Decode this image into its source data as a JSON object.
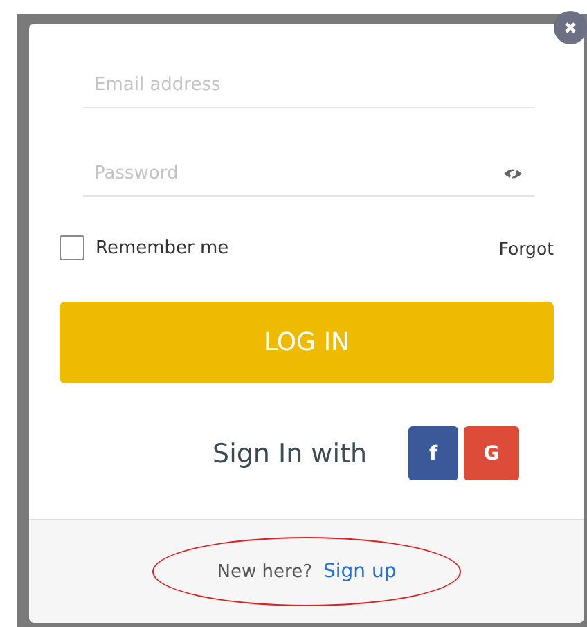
{
  "email": {
    "placeholder": "Email address"
  },
  "password": {
    "placeholder": "Password"
  },
  "remember": {
    "label": "Remember me",
    "checked": false
  },
  "forgot": "Forgot",
  "login_button": "LOG IN",
  "social": {
    "label": "Sign In with",
    "buttons": [
      {
        "kind": "facebook",
        "label": "f"
      },
      {
        "kind": "google",
        "label": "G"
      }
    ]
  },
  "footer": {
    "text": "New here?",
    "link": "Sign up",
    "highlighted": true
  }
}
